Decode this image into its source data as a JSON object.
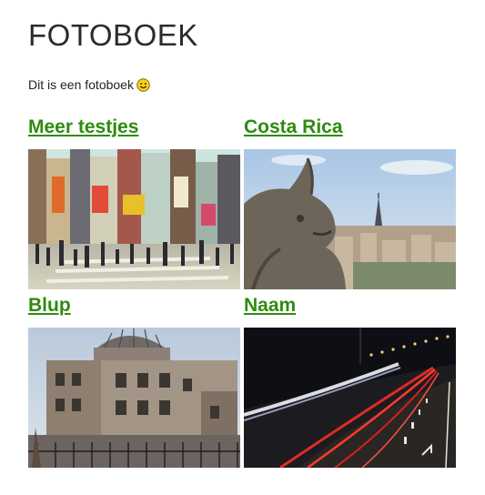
{
  "page": {
    "title": "FOTOBOEK",
    "intro": "Dit is een fotoboek",
    "intro_icon": "smiley-icon"
  },
  "albums": [
    {
      "title": "Meer testjes",
      "image": "city-crosswalk-photo"
    },
    {
      "title": "Costa Rica",
      "image": "gargoyle-paris-photo"
    },
    {
      "title": "Blup",
      "image": "ruined-dome-building-photo"
    },
    {
      "title": "Naam",
      "image": "night-highway-light-trails-photo"
    }
  ],
  "colors": {
    "link": "#2e8b10",
    "title": "#2b2b2b"
  }
}
